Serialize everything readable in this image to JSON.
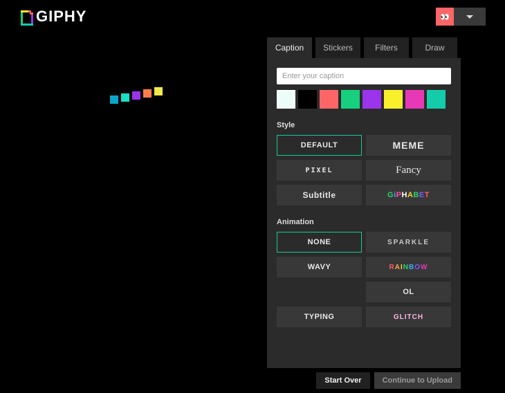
{
  "brand": "GIPHY",
  "user": {
    "avatar_glyph": "👀"
  },
  "tabs": [
    {
      "label": "Caption",
      "active": true
    },
    {
      "label": "Stickers",
      "active": false
    },
    {
      "label": "Filters",
      "active": false
    },
    {
      "label": "Draw",
      "active": false
    }
  ],
  "caption": {
    "placeholder": "Enter your caption",
    "value": ""
  },
  "swatches": [
    {
      "name": "white",
      "hex": "#ffffff",
      "selected": true
    },
    {
      "name": "black",
      "hex": "#000000"
    },
    {
      "name": "coral",
      "hex": "#fd6666"
    },
    {
      "name": "green",
      "hex": "#17d07d"
    },
    {
      "name": "purple",
      "hex": "#9b34eb"
    },
    {
      "name": "yellow",
      "hex": "#f9ef2b"
    },
    {
      "name": "magenta",
      "hex": "#e738b6"
    },
    {
      "name": "teal",
      "hex": "#14ccaa"
    }
  ],
  "sections": {
    "style": {
      "label": "Style",
      "options": [
        {
          "key": "default",
          "label": "DEFAULT",
          "selected": true
        },
        {
          "key": "meme",
          "label": "MEME"
        },
        {
          "key": "pixel",
          "label": "PIXEL"
        },
        {
          "key": "fancy",
          "label": "Fancy"
        },
        {
          "key": "subtitle",
          "label": "Subtitle"
        },
        {
          "key": "alphabet",
          "label": "GiPHABET"
        }
      ]
    },
    "animation": {
      "label": "Animation",
      "options": [
        {
          "key": "none",
          "label": "NONE",
          "selected": true
        },
        {
          "key": "sparkle",
          "label": "SPARKLE"
        },
        {
          "key": "wavy",
          "label": "WAVY"
        },
        {
          "key": "rainbow",
          "label": "RAINBOW"
        },
        {
          "key": "blank",
          "label": ""
        },
        {
          "key": "ol",
          "label": "OL"
        },
        {
          "key": "typing",
          "label": "TYPING"
        },
        {
          "key": "glitch",
          "label": "GLITCH"
        }
      ]
    }
  },
  "footer": {
    "start_over": "Start Over",
    "continue": "Continue to Upload"
  },
  "loader_colors": [
    "#0aa6c7",
    "#18e0c5",
    "#9b34eb",
    "#fd7e4b",
    "#f2e94b"
  ],
  "alphabet_colors": [
    "#2bd46b",
    "#3fa9f5",
    "#ff4fa3",
    "#ffffff",
    "#f7d038",
    "#2bd46b",
    "#7a5cff",
    "#ff5d5d"
  ]
}
